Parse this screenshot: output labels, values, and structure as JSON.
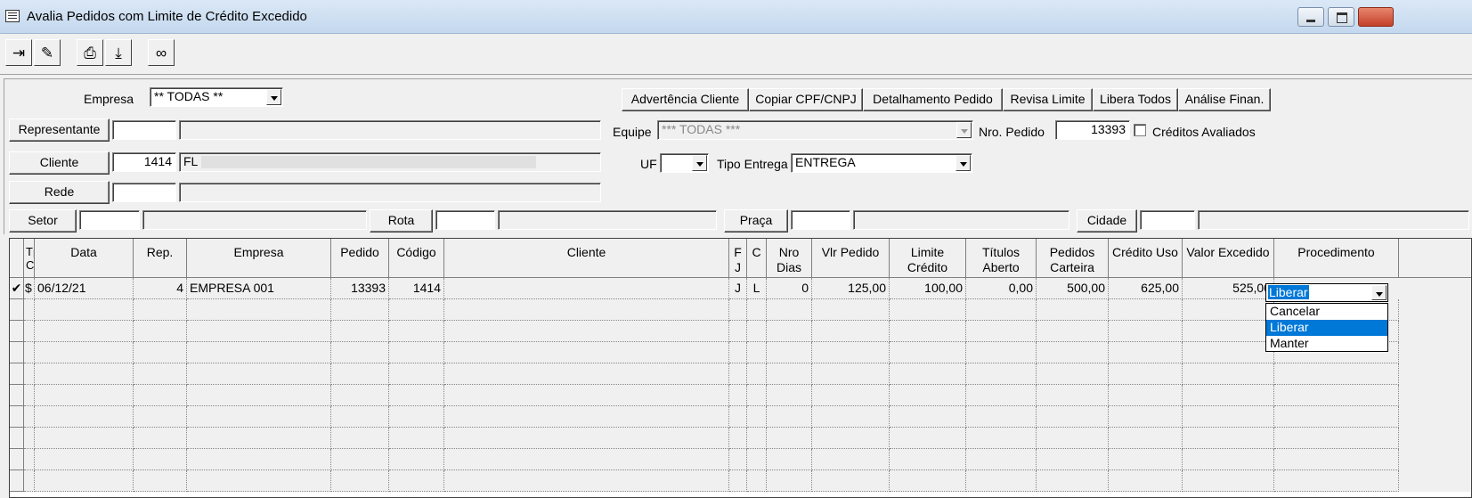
{
  "window": {
    "title": "Avalia Pedidos com Limite de Crédito Excedido"
  },
  "toolbar": {
    "buttons": [
      {
        "icon": "exit-door-icon",
        "glyph": "⇥"
      },
      {
        "icon": "pencil-icon",
        "glyph": "✎"
      },
      {
        "icon": "printer-icon",
        "glyph": "⎙"
      },
      {
        "icon": "export-icon",
        "glyph": "⤓"
      },
      {
        "icon": "binoculars-icon",
        "glyph": "∞"
      }
    ]
  },
  "filters": {
    "empresa_label": "Empresa",
    "empresa_value": "** TODAS **",
    "representante_button": "Representante",
    "representante_code": "",
    "representante_name": "",
    "cliente_button": "Cliente",
    "cliente_code": "1414",
    "cliente_name": "FL",
    "rede_button": "Rede",
    "rede_code": "",
    "rede_name": "",
    "setor_button": "Setor",
    "setor_code": "",
    "setor_name": "",
    "rota_button": "Rota",
    "rota_code": "",
    "rota_name": "",
    "praca_button": "Praça",
    "praca_code": "",
    "praca_name": "",
    "cidade_button": "Cidade",
    "cidade_code": "",
    "cidade_name": "",
    "equipe_label": "Equipe",
    "equipe_value": "*** TODAS ***",
    "nro_pedido_label": "Nro. Pedido",
    "nro_pedido_value": "13393",
    "creditos_avaliados_label": "Créditos Avaliados",
    "uf_label": "UF",
    "uf_value": "",
    "tipo_entrega_label": "Tipo Entrega",
    "tipo_entrega_value": "ENTREGA"
  },
  "actions": {
    "advertencia": "Advertência Cliente",
    "copiar_cpf": "Copiar CPF/CNPJ",
    "detalhamento": "Detalhamento Pedido",
    "revisa_limite": "Revisa Limite",
    "libera_todos": "Libera Todos",
    "analise_finan": "Análise Finan."
  },
  "grid": {
    "headers": {
      "tp": "Tp Cr",
      "data": "Data",
      "rep": "Rep.",
      "empresa": "Empresa",
      "pedido": "Pedido",
      "codigo": "Código",
      "cliente": "Cliente",
      "fj": "F J",
      "c": "C",
      "nro_dias": "Nro Dias",
      "vlr_pedido": "Vlr Pedido",
      "limite_credito": "Limite Crédito",
      "titulos_aberto": "Títulos Aberto",
      "pedidos_carteira": "Pedidos Carteira",
      "credito_uso": "Crédito Uso",
      "valor_excedido": "Valor Excedido",
      "procedimento": "Procedimento"
    },
    "rows": [
      {
        "indicator": "✔",
        "tp": "$",
        "data": "06/12/21",
        "rep": "4",
        "empresa": "EMPRESA 001",
        "pedido": "13393",
        "codigo": "1414",
        "cliente": "",
        "fj": "J",
        "c": "L",
        "nro_dias": "0",
        "vlr_pedido": "125,00",
        "limite_credito": "100,00",
        "titulos_aberto": "0,00",
        "pedidos_carteira": "500,00",
        "credito_uso": "625,00",
        "valor_excedido": "525,00",
        "procedimento": "Liberar"
      }
    ],
    "procedimento_options": [
      "Cancelar",
      "Liberar",
      "Manter"
    ],
    "procedimento_selected": "Liberar"
  }
}
